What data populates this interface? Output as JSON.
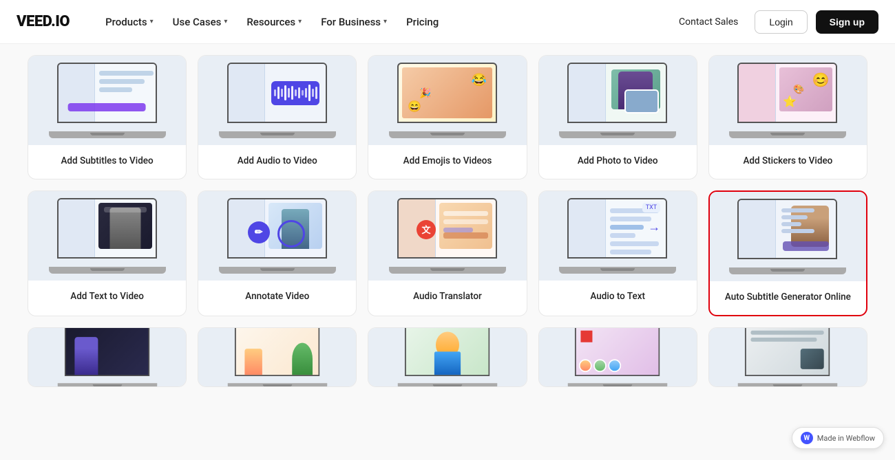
{
  "logo": "VEED.IO",
  "nav": {
    "items": [
      {
        "label": "Products",
        "hasDropdown": true
      },
      {
        "label": "Use Cases",
        "hasDropdown": true
      },
      {
        "label": "Resources",
        "hasDropdown": true
      },
      {
        "label": "For Business",
        "hasDropdown": true
      },
      {
        "label": "Pricing",
        "hasDropdown": false
      }
    ],
    "contact": "Contact Sales",
    "login": "Login",
    "signup": "Sign up"
  },
  "rows": [
    {
      "cards": [
        {
          "label": "Add Subtitles to Video",
          "highlighted": false,
          "screenType": "subtitles"
        },
        {
          "label": "Add Audio to Video",
          "highlighted": false,
          "screenType": "audio"
        },
        {
          "label": "Add Emojis to Videos",
          "highlighted": false,
          "screenType": "emojis"
        },
        {
          "label": "Add Photo to Video",
          "highlighted": false,
          "screenType": "photo"
        },
        {
          "label": "Add Stickers to Video",
          "highlighted": false,
          "screenType": "stickers"
        }
      ]
    },
    {
      "cards": [
        {
          "label": "Add Text to Video",
          "highlighted": false,
          "screenType": "text"
        },
        {
          "label": "Annotate Video",
          "highlighted": false,
          "screenType": "annotate"
        },
        {
          "label": "Audio Translator",
          "highlighted": false,
          "screenType": "translator"
        },
        {
          "label": "Audio to Text",
          "highlighted": false,
          "screenType": "audiototext"
        },
        {
          "label": "Auto Subtitle Generator Online",
          "highlighted": true,
          "screenType": "autosubtitle"
        }
      ]
    },
    {
      "cards": [
        {
          "label": "",
          "highlighted": false,
          "screenType": "mini1"
        },
        {
          "label": "",
          "highlighted": false,
          "screenType": "mini2"
        },
        {
          "label": "",
          "highlighted": false,
          "screenType": "mini3"
        },
        {
          "label": "",
          "highlighted": false,
          "screenType": "mini4"
        },
        {
          "label": "",
          "highlighted": false,
          "screenType": "mini5"
        }
      ]
    }
  ],
  "webflow": {
    "badge": "Made in Webflow"
  }
}
